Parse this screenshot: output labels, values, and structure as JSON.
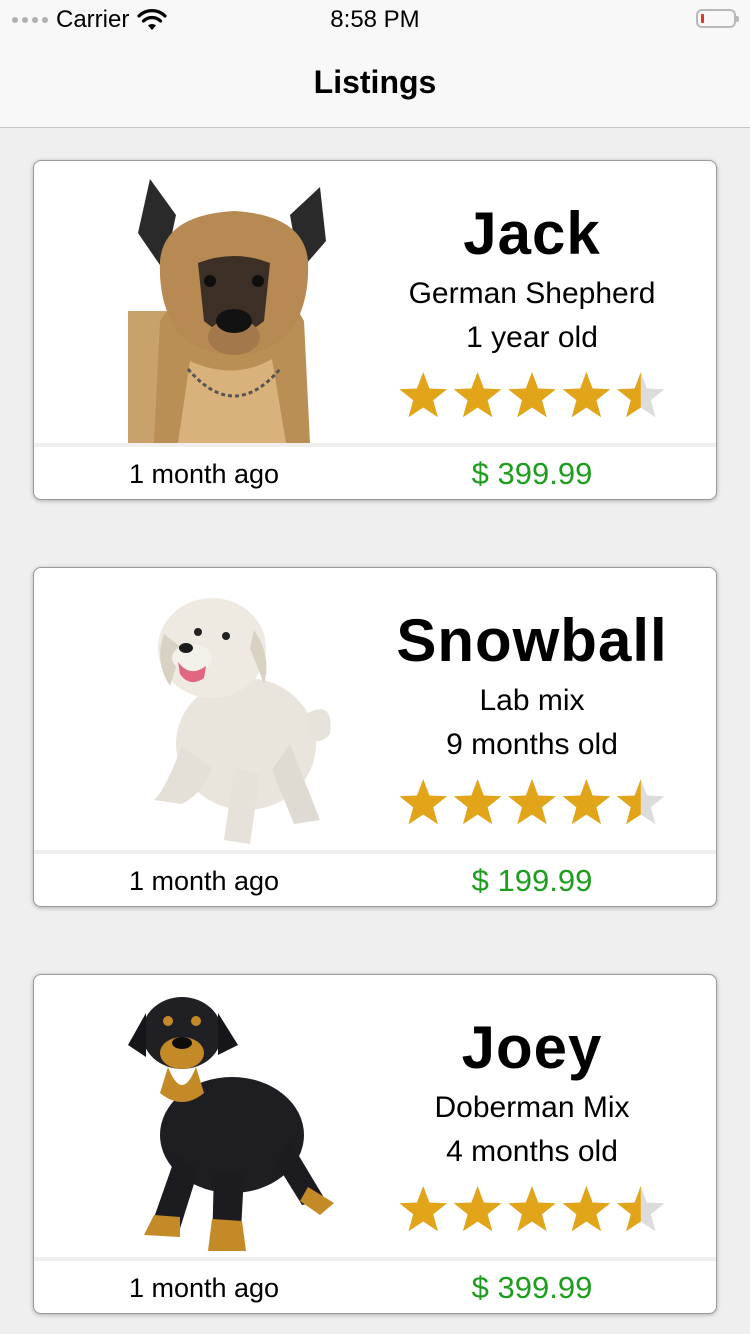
{
  "status_bar": {
    "carrier": "Carrier",
    "time": "8:58 PM",
    "signal_icon": "signal-dots-icon",
    "wifi_icon": "wifi-icon",
    "battery_icon": "battery-low-icon",
    "battery_color": "#e8312a"
  },
  "nav": {
    "title": "Listings"
  },
  "colors": {
    "price": "#1f9d1f",
    "star": "#e2a519",
    "star_empty": "#dcdcdc"
  },
  "listings": [
    {
      "name": "Jack",
      "breed": "German Shepherd",
      "age": "1 year old",
      "rating": 4.5,
      "rating_max": 5,
      "posted": "1 month ago",
      "price": "$ 399.99",
      "image_icon": "german-shepherd-photo"
    },
    {
      "name": "Snowball",
      "breed": "Lab mix",
      "age": "9 months old",
      "rating": 4.5,
      "rating_max": 5,
      "posted": "1 month ago",
      "price": "$ 199.99",
      "image_icon": "white-puppy-photo"
    },
    {
      "name": "Joey",
      "breed": "Doberman Mix",
      "age": "4 months old",
      "rating": 4.5,
      "rating_max": 5,
      "posted": "1 month ago",
      "price": "$ 399.99",
      "image_icon": "doberman-puppy-photo"
    }
  ]
}
